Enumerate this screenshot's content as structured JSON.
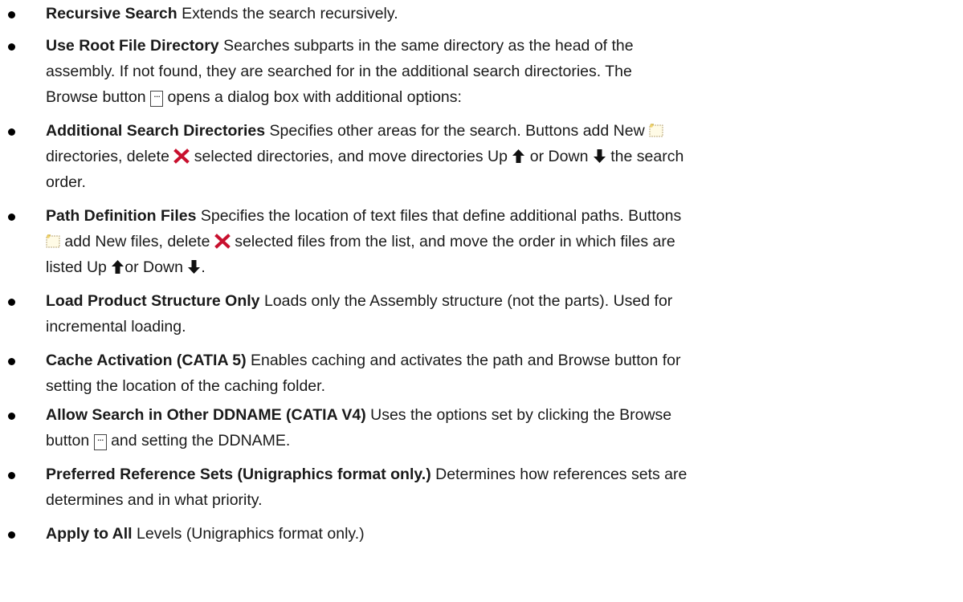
{
  "items": [
    {
      "term": "Recursive Search",
      "desc": "Extends the search recursively."
    },
    {
      "term": "Use Root File Directory",
      "desc1": "Searches subparts in the same directory as the head of the",
      "desc2": "assembly. If not found, they are searched for in the additional search directories. The",
      "desc3a": "Browse button",
      "browse": "...",
      "desc3b": "opens a dialog box with additional options:"
    },
    {
      "term": "Additional Search Directories",
      "desc1a": "Specifies other areas for the search. Buttons add New",
      "desc2a": "directories, delete",
      "desc2b": "selected directories, and move directories Up",
      "desc2c": "or Down",
      "desc2d": "the search",
      "desc3": "order."
    },
    {
      "term": "Path Definition Files",
      "desc1": "Specifies the location of text files that define additional paths. Buttons",
      "desc2a": "add New files, delete",
      "desc2b": "selected files from the list, and move the order in which files are",
      "desc3a": "listed Up",
      "desc3b": "or Down",
      "desc3c": "."
    },
    {
      "term": "Load Product Structure Only",
      "desc1": "Loads only the Assembly structure (not the parts). Used for",
      "desc2": "incremental loading."
    },
    {
      "term": "Cache Activation (CATIA 5)",
      "desc1": "Enables caching and activates the path and Browse button for",
      "desc2": "setting the location of the caching folder."
    },
    {
      "term": "Allow Search in Other DDNAME (CATIA V4)",
      "desc1": "Uses the options set by clicking the Browse",
      "desc2a": "button",
      "browse": "...",
      "desc2b": "and setting the DDNAME."
    },
    {
      "term": "Preferred Reference Sets (Unigraphics format only.)",
      "desc1": "Determines how references sets are",
      "desc2": "determines and in what priority."
    },
    {
      "term": "Apply to All",
      "desc": "Levels (Unigraphics format only.)"
    }
  ],
  "icons": {
    "new": "new-file-icon",
    "delete": "delete-x-icon",
    "up": "arrow-up-icon",
    "down": "arrow-down-icon",
    "browse": "browse-button-icon",
    "delete_color": "#c8102e"
  }
}
